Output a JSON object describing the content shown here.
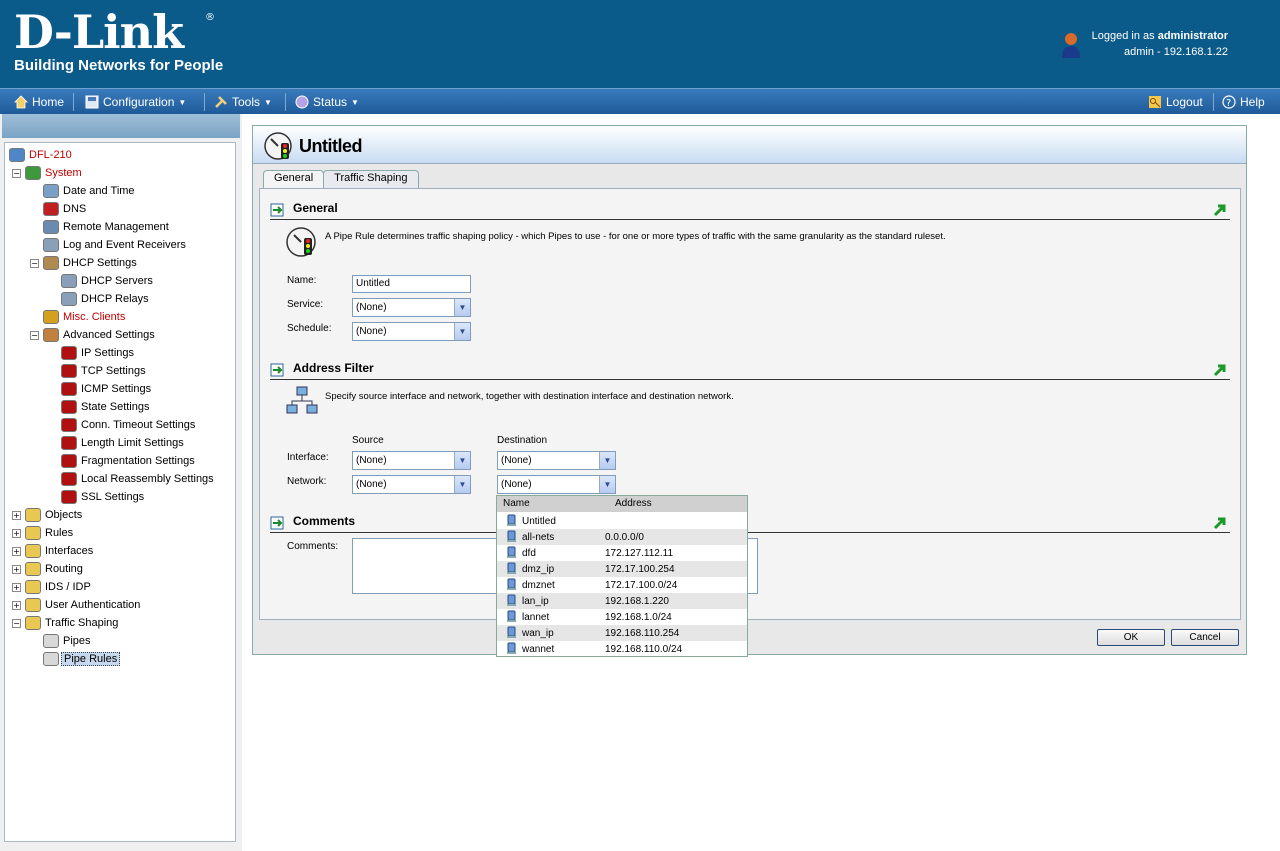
{
  "header": {
    "logo": "D-Link",
    "tagline": "Building Networks for People",
    "logged_in_prefix": "Logged in as",
    "username": "administrator",
    "session": "admin - 192.168.1.22"
  },
  "menu": {
    "home": "Home",
    "configuration": "Configuration",
    "tools": "Tools",
    "status": "Status",
    "logout": "Logout",
    "help": "Help"
  },
  "tree": [
    {
      "label": "DFL-210",
      "red": true
    },
    {
      "label": "System",
      "red": true
    },
    {
      "label": "Date and Time"
    },
    {
      "label": "DNS"
    },
    {
      "label": "Remote Management"
    },
    {
      "label": "Log and Event Receivers"
    },
    {
      "label": "DHCP Settings"
    },
    {
      "label": "DHCP Servers"
    },
    {
      "label": "DHCP Relays"
    },
    {
      "label": "Misc. Clients",
      "red": true
    },
    {
      "label": "Advanced Settings"
    },
    {
      "label": "IP Settings"
    },
    {
      "label": "TCP Settings"
    },
    {
      "label": "ICMP Settings"
    },
    {
      "label": "State Settings"
    },
    {
      "label": "Conn. Timeout Settings"
    },
    {
      "label": "Length Limit Settings"
    },
    {
      "label": "Fragmentation Settings"
    },
    {
      "label": "Local Reassembly Settings"
    },
    {
      "label": "SSL Settings"
    },
    {
      "label": "Objects"
    },
    {
      "label": "Rules"
    },
    {
      "label": "Interfaces"
    },
    {
      "label": "Routing"
    },
    {
      "label": "IDS / IDP"
    },
    {
      "label": "User Authentication"
    },
    {
      "label": "Traffic Shaping"
    },
    {
      "label": "Pipes"
    },
    {
      "label": "Pipe Rules",
      "selected": true
    }
  ],
  "panel": {
    "title": "Untitled",
    "tabs": [
      "General",
      "Traffic Shaping"
    ],
    "general": {
      "heading": "General",
      "description": "A Pipe Rule determines traffic shaping policy - which Pipes to use - for one or more types of traffic with the same granularity as the standard ruleset.",
      "name_label": "Name:",
      "name_value": "Untitled",
      "service_label": "Service:",
      "service_value": "(None)",
      "schedule_label": "Schedule:",
      "schedule_value": "(None)"
    },
    "address_filter": {
      "heading": "Address Filter",
      "description": "Specify source interface and network, together with destination interface and destination network.",
      "source_label": "Source",
      "destination_label": "Destination",
      "interface_label": "Interface:",
      "network_label": "Network:",
      "src_interface": "(None)",
      "src_network": "(None)",
      "dst_interface": "(None)",
      "dst_network": "(None)"
    },
    "comments": {
      "heading": "Comments",
      "label": "Comments:"
    },
    "ok": "OK",
    "cancel": "Cancel"
  },
  "dropdown": {
    "col_name": "Name",
    "col_address": "Address",
    "rows": [
      {
        "name": "Untitled",
        "address": ""
      },
      {
        "name": "all-nets",
        "address": "0.0.0.0/0"
      },
      {
        "name": "dfd",
        "address": "172.127.112.11"
      },
      {
        "name": "dmz_ip",
        "address": "172.17.100.254"
      },
      {
        "name": "dmznet",
        "address": "172.17.100.0/24"
      },
      {
        "name": "lan_ip",
        "address": "192.168.1.220"
      },
      {
        "name": "lannet",
        "address": "192.168.1.0/24"
      },
      {
        "name": "wan_ip",
        "address": "192.168.110.254"
      },
      {
        "name": "wannet",
        "address": "192.168.110.0/24"
      }
    ]
  }
}
